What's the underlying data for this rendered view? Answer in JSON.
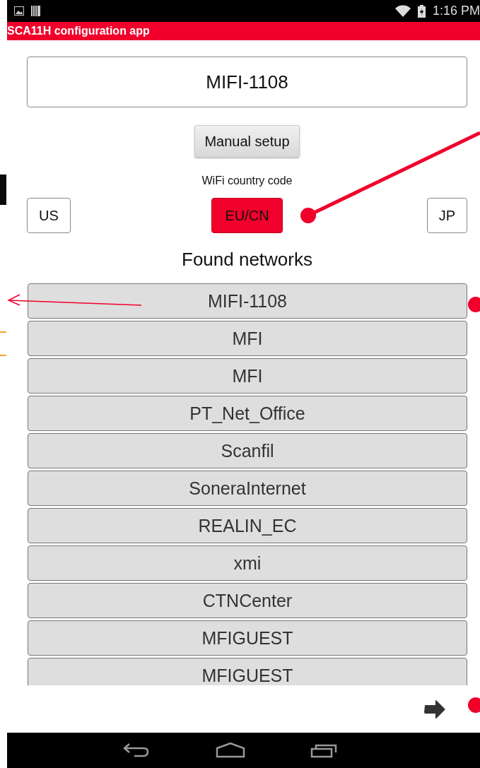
{
  "status_bar": {
    "time": "1:16 PM"
  },
  "title_bar": {
    "title": "SCA11H configuration app"
  },
  "device_name": {
    "value": "MIFI-1108"
  },
  "manual_setup_button": "Manual setup",
  "country_code": {
    "label": "WiFi country code",
    "options": [
      {
        "label": "US",
        "selected": false
      },
      {
        "label": "EU/CN",
        "selected": true
      },
      {
        "label": "JP",
        "selected": false
      }
    ]
  },
  "found_networks": {
    "heading": "Found networks",
    "items": [
      "MIFI-1108",
      "MFI",
      "MFI",
      "PT_Net_Office",
      "Scanfil",
      "SoneraInternet",
      "REALIN_EC",
      "xmi",
      "CTNCenter",
      "MFIGUEST",
      "MFIGUEST"
    ]
  }
}
